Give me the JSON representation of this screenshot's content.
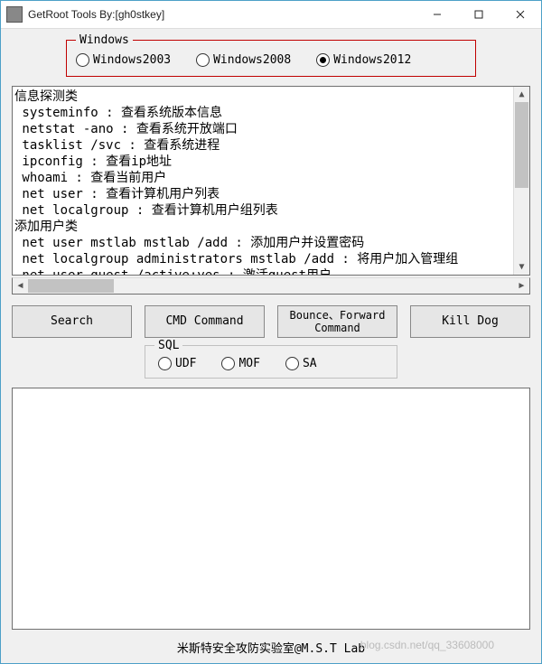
{
  "window": {
    "title": "GetRoot Tools By:[gh0stkey]"
  },
  "osGroup": {
    "legend": "Windows",
    "options": [
      {
        "label": "Windows2003",
        "selected": false
      },
      {
        "label": "Windows2008",
        "selected": false
      },
      {
        "label": "Windows2012",
        "selected": true
      }
    ]
  },
  "commandText": "信息探测类\n systeminfo : 查看系统版本信息\n netstat -ano : 查看系统开放端口\n tasklist /svc : 查看系统进程\n ipconfig : 查看ip地址\n whoami : 查看当前用户\n net user : 查看计算机用户列表\n net localgroup : 查看计算机用户组列表\n添加用户类\n net user mstlab mstlab /add : 添加用户并设置密码\n net localgroup administrators mstlab /add : 将用户加入管理组\n net user guest /active:yes : 激活guest用户",
  "buttons": {
    "search": "Search",
    "cmd": "CMD Command",
    "bounce": "Bounce、Forward\nCommand",
    "kill": "Kill Dog"
  },
  "sqlGroup": {
    "legend": "SQL",
    "options": [
      {
        "label": "UDF",
        "selected": false
      },
      {
        "label": "MOF",
        "selected": false
      },
      {
        "label": "SA",
        "selected": false
      }
    ]
  },
  "footer": {
    "text": "米斯特安全攻防实验室@M.S.T Lab",
    "watermark": "blog.csdn.net/qq_33608000"
  }
}
